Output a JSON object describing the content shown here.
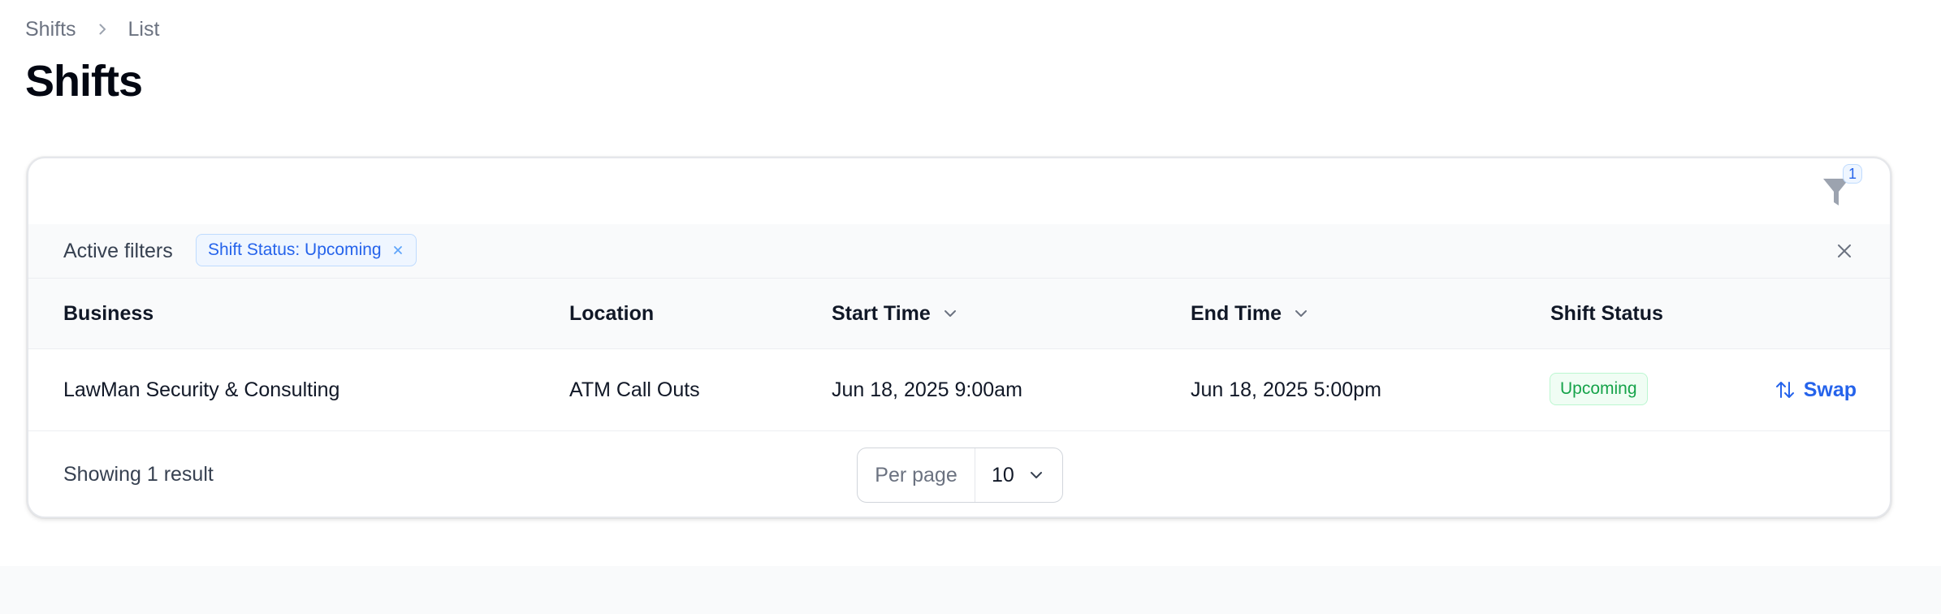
{
  "breadcrumb": {
    "items": [
      "Shifts",
      "List"
    ]
  },
  "page": {
    "title": "Shifts"
  },
  "toolbar": {
    "filter_count": "1",
    "filter_icon": "funnel-icon"
  },
  "active_filters": {
    "label": "Active filters",
    "chips": [
      {
        "label": "Shift Status: Upcoming"
      }
    ]
  },
  "table": {
    "columns": [
      {
        "label": "Business",
        "sortable": false
      },
      {
        "label": "Location",
        "sortable": false
      },
      {
        "label": "Start Time",
        "sortable": true
      },
      {
        "label": "End Time",
        "sortable": true
      },
      {
        "label": "Shift Status",
        "sortable": false
      }
    ],
    "rows": [
      {
        "business": "LawMan Security & Consulting",
        "location": "ATM Call Outs",
        "start_time": "Jun 18, 2025 9:00am",
        "end_time": "Jun 18, 2025 5:00pm",
        "status": "Upcoming",
        "action": "Swap"
      }
    ]
  },
  "footer": {
    "showing": "Showing 1 result",
    "per_page_label": "Per page",
    "per_page_value": "10"
  },
  "colors": {
    "accent": "#2563eb",
    "success": "#16a34a",
    "muted": "#6b7280"
  }
}
